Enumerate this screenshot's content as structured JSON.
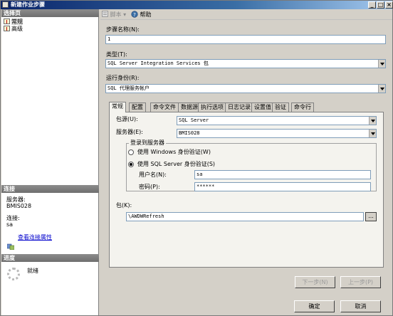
{
  "window": {
    "title": "新建作业步骤"
  },
  "left": {
    "select_page_header": "选择页",
    "pages": [
      {
        "label": "常规"
      },
      {
        "label": "高级"
      }
    ],
    "connection_header": "连接",
    "server_label": "服务器:",
    "server_value": "BMIS028",
    "connection_label": "连接:",
    "connection_value": "sa",
    "view_conn_props": "查看连接属性",
    "progress_header": "进度",
    "progress_status": "就绪"
  },
  "toolbar": {
    "script_label": "脚本",
    "help_label": "帮助"
  },
  "form": {
    "step_name_label": "步骤名称(N):",
    "step_name_value": "1",
    "type_label": "类型(T):",
    "type_value": "SQL Server Integration Services 包",
    "run_as_label": "运行身份(R):",
    "run_as_value": "SQL 代理服务帐户"
  },
  "tabs": [
    {
      "label": "常规"
    },
    {
      "label": "配置"
    },
    {
      "label": "命令文件"
    },
    {
      "label": "数据源"
    },
    {
      "label": "执行选项"
    },
    {
      "label": "日志记录"
    },
    {
      "label": "设置值"
    },
    {
      "label": "验证"
    },
    {
      "label": "命令行"
    }
  ],
  "general": {
    "pkg_source_label": "包源(U):",
    "pkg_source_value": "SQL Server",
    "server_label": "服务器(E):",
    "server_value": "BMIS028",
    "login_group_title": "登录到服务器",
    "windows_auth_label": "使用 Windows 身份验证(W)",
    "sql_auth_label": "使用 SQL Server 身份验证(S)",
    "username_label": "用户名(N):",
    "username_value": "sa",
    "password_label": "密码(P):",
    "password_value": "******",
    "package_label": "包(K):",
    "package_value": "\\AWDWRefresh",
    "browse_label": "..."
  },
  "buttons": {
    "next_label": "下一步(N)",
    "prev_label": "上一步(P)",
    "ok_label": "确定",
    "cancel_label": "取消"
  }
}
